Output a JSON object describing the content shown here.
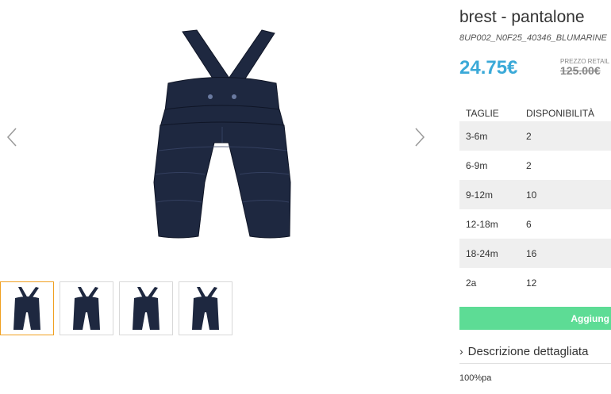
{
  "product": {
    "title": "brest - pantalone",
    "sku": "8UP002_N0F25_40346_BLUMARINE",
    "price": "24.75€",
    "retail_label": "PREZZO RETAIL",
    "retail_price": "125.00€"
  },
  "sizes_table": {
    "headers": [
      "TAGLIE",
      "DISPONIBILITÀ"
    ],
    "rows": [
      {
        "size": "3-6m",
        "qty": "2"
      },
      {
        "size": "6-9m",
        "qty": "2"
      },
      {
        "size": "9-12m",
        "qty": "10"
      },
      {
        "size": "12-18m",
        "qty": "6"
      },
      {
        "size": "18-24m",
        "qty": "16"
      },
      {
        "size": "2a",
        "qty": "12"
      }
    ]
  },
  "add_button": "Aggiung",
  "description": {
    "toggle_label": "Descrizione dettagliata",
    "text": "100%pa"
  },
  "colors": {
    "price": "#3aa9d8",
    "button": "#5ddc95",
    "product": "#1e2840",
    "thumb_active_border": "#f0a020"
  },
  "icons": {
    "prev": "chevron-left-icon",
    "next": "chevron-right-icon",
    "toggle": "chevron-right-icon"
  }
}
